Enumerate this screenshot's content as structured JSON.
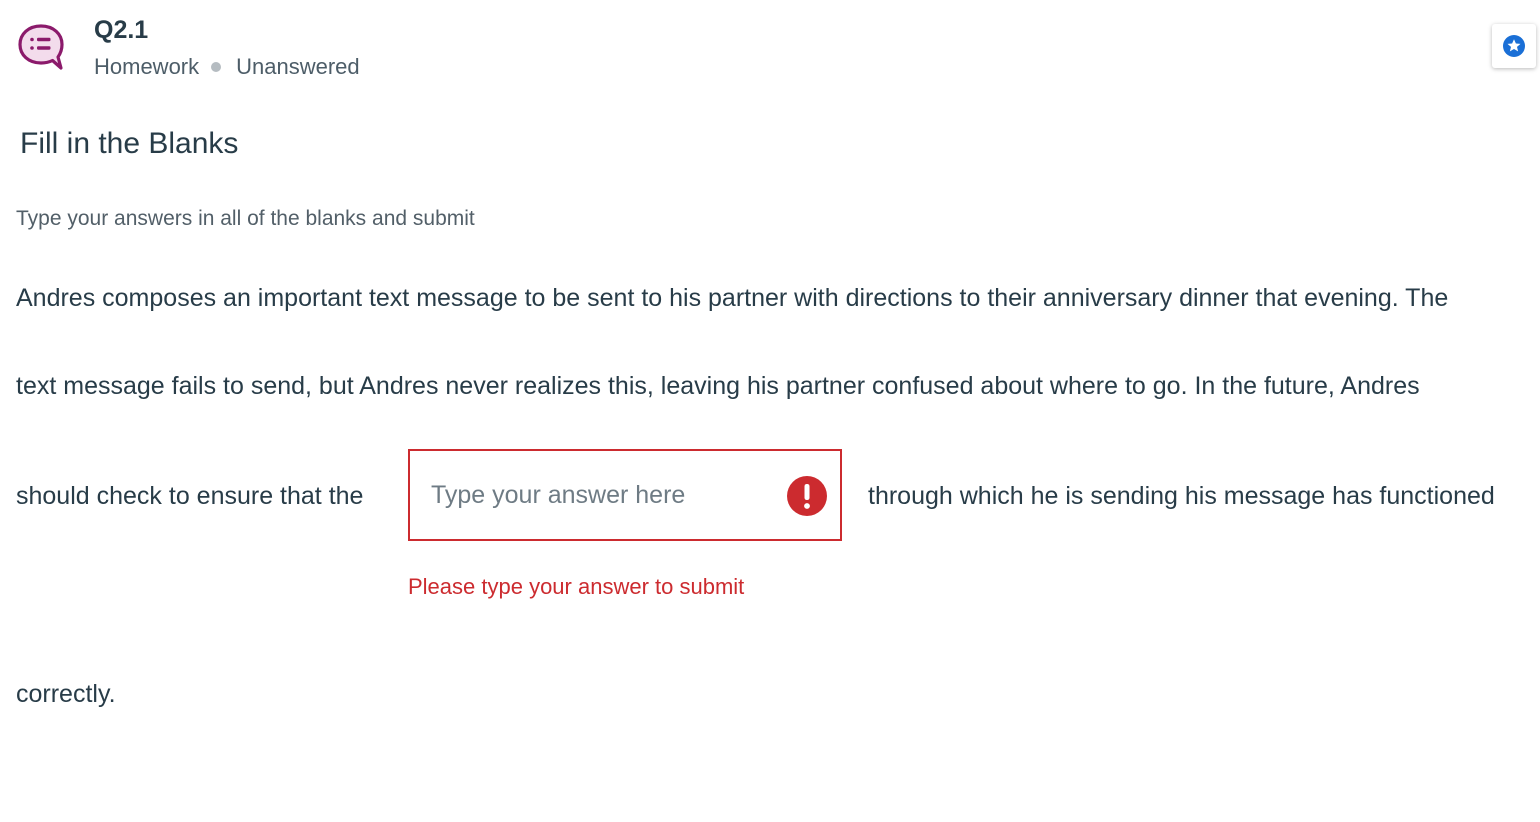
{
  "question": {
    "id": "Q2.1",
    "type": "Homework",
    "status": "Unanswered",
    "title": "Fill in the Blanks",
    "instructions": "Type your answers in all of the blanks and submit"
  },
  "passage": {
    "line1": "Andres composes an important text message to be sent to his partner with directions to their anniversary dinner that evening. The",
    "line2": "text message fails to send, but Andres never realizes this, leaving his partner confused about where to go. In the future, Andres",
    "line3_before_blank": "should check to ensure that the",
    "line3_after_blank": "through which he is sending his message has functioned",
    "line4": "correctly."
  },
  "blank": {
    "value": "",
    "placeholder": "Type your answer here",
    "error_message": "Please type your answer to submit"
  },
  "icons": {
    "question": "chat-bubble-list-icon",
    "bookmark": "star-icon",
    "error": "exclamation-icon"
  },
  "colors": {
    "question_icon": "#8b1a6b",
    "question_icon_fill": "#f3dcec",
    "bookmark": "#1a6fd6",
    "error": "#cc2b2f",
    "text": "#283c48"
  }
}
